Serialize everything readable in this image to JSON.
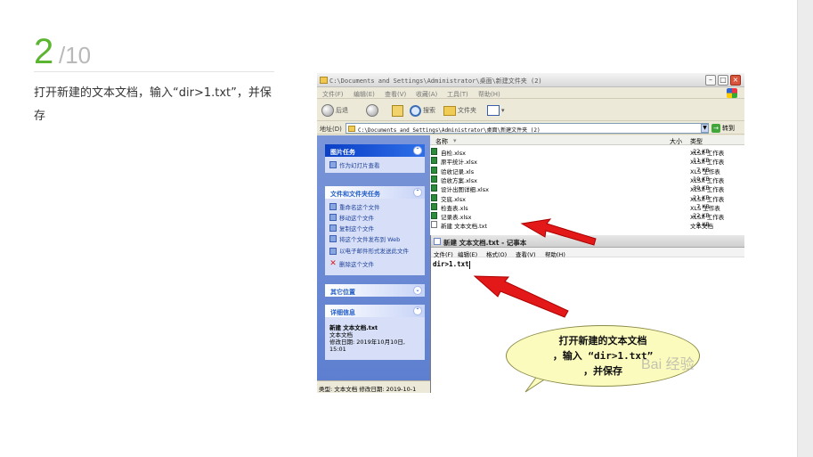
{
  "step": {
    "current": "2",
    "total": "/10",
    "instruction": "打开新建的文本文档，输入“dir>1.txt”，并保存"
  },
  "explorer": {
    "title": "C:\\Documents and Settings\\Administrator\\桌面\\新建文件夹 (2)",
    "menu": [
      "文件(F)",
      "编辑(E)",
      "查看(V)",
      "收藏(A)",
      "工具(T)",
      "帮助(H)"
    ],
    "toolbar": {
      "back": "后退",
      "search": "搜索",
      "folders": "文件夹"
    },
    "address_label": "地址(D)",
    "address_value": "C:\\Documents and Settings\\Administrator\\桌面\\新建文件夹 (2)",
    "go_label": "转到",
    "columns": {
      "name": "名称",
      "size": "大小",
      "type": "类型"
    },
    "files": [
      {
        "name": "自检.xlsx",
        "size": "22 KB",
        "type": "XLSX 工作表"
      },
      {
        "name": "原平统计.xlsx",
        "size": "11 KB",
        "type": "XLSX 工作表"
      },
      {
        "name": "验收记录.xls",
        "size": "7 KB",
        "type": "XLS 工作表"
      },
      {
        "name": "验收方案.xlsx",
        "size": "10 KB",
        "type": "XLSX 工作表"
      },
      {
        "name": "设计出图详细.xlsx",
        "size": "30 KB",
        "type": "XLSX 工作表"
      },
      {
        "name": "交底.xlsx",
        "size": "21 KB",
        "type": "XLSX 工作表"
      },
      {
        "name": "检查表.xls",
        "size": "7 KB",
        "type": "XLS 工作表"
      },
      {
        "name": "记录表.xlsx",
        "size": "22 KB",
        "type": "XLSX 工作表"
      },
      {
        "name": "新建 文本文档.txt",
        "size": "0 KB",
        "type": "文本文档"
      }
    ],
    "tasks": {
      "picture_header": "图片任务",
      "picture_items": [
        "作为幻灯片查看"
      ],
      "file_header": "文件和文件夹任务",
      "file_items": [
        "重命名这个文件",
        "移动这个文件",
        "复制这个文件",
        "将这个文件发布到 Web",
        "以电子邮件形式发送此文件",
        "删除这个文件"
      ],
      "other_header": "其它位置",
      "details_header": "详细信息",
      "details": {
        "name": "新建 文本文档.txt",
        "kind": "文本文档",
        "modified_label": "修改日期: 2019年10月10日,",
        "modified_time": "15:01"
      }
    },
    "status": "类型: 文本文档 修改日期: 2019-10-1"
  },
  "notepad": {
    "title": "新建 文本文档.txt - 记事本",
    "menu": [
      "文件(F)",
      "编辑(E)",
      "格式(O)",
      "查看(V)",
      "帮助(H)"
    ],
    "content": "dir>1.txt"
  },
  "callout": {
    "line1": "打开新建的文本文档",
    "line2": "，输入 “dir>1.txt”",
    "line3": "，并保存"
  },
  "watermark": "Bai 经验"
}
